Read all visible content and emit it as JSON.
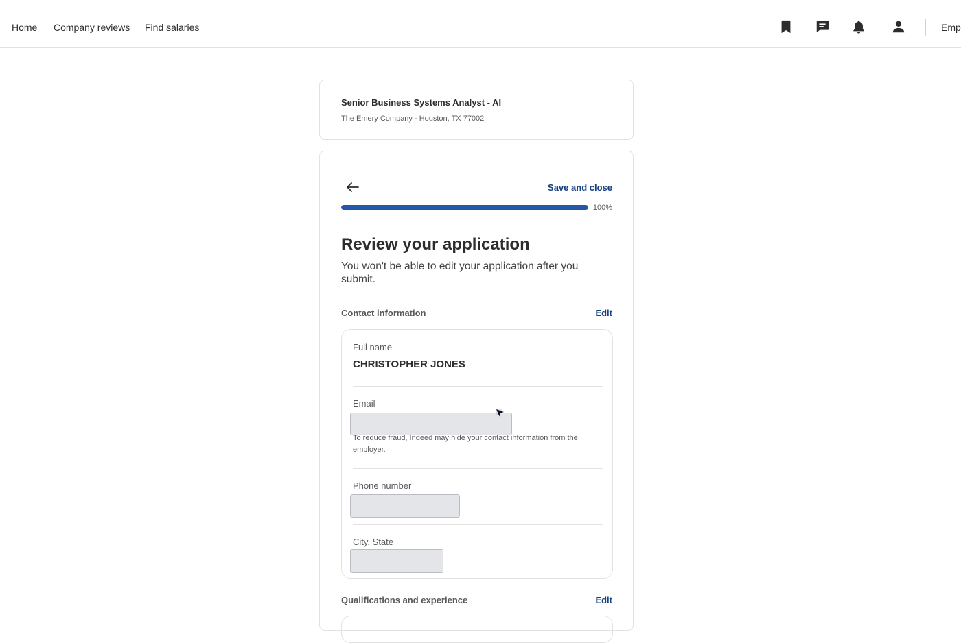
{
  "nav": {
    "home": "Home",
    "company_reviews": "Company reviews",
    "find_salaries": "Find salaries",
    "employers": "Emp",
    "icons": [
      "bookmark-icon",
      "messages-icon",
      "notifications-icon",
      "profile-icon"
    ]
  },
  "job": {
    "title": "Senior Business Systems Analyst - AI",
    "company_location": "The Emery Company - Houston, TX 77002"
  },
  "application": {
    "save_close": "Save and close",
    "progress_label": "100%",
    "progress_value": 1.0,
    "title": "Review your application",
    "subtitle": "You won't be able to edit your application after you submit.",
    "contact_section": {
      "label": "Contact information",
      "edit": "Edit",
      "full_name_label": "Full name",
      "full_name_value": "CHRISTOPHER JONES",
      "email_label": "Email",
      "email_note": "To reduce fraud, Indeed may hide your contact information from the employer.",
      "phone_label": "Phone number",
      "city_label": "City, State"
    },
    "qualifications_section": {
      "label": "Qualifications and experience",
      "edit": "Edit"
    }
  },
  "colors": {
    "accent": "#2557a7",
    "link": "#164081"
  }
}
